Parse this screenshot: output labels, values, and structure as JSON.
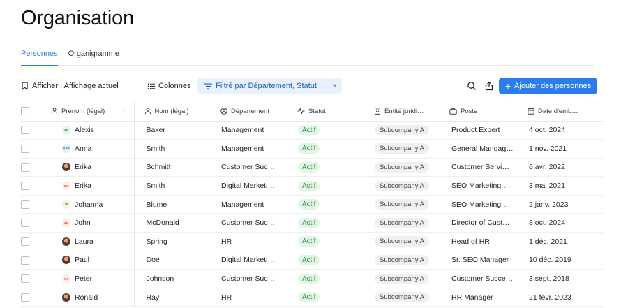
{
  "page": {
    "title": "Organisation"
  },
  "tabs": [
    {
      "label": "Personnes",
      "active": true
    },
    {
      "label": "Organigramme",
      "active": false
    }
  ],
  "toolbar": {
    "view_label": "Afficher : Affichage actuel",
    "columns_label": "Colonnes",
    "filter_label": "Filtré par Département, Statut",
    "filter_close": "×",
    "search_icon": "search-icon",
    "export_icon": "share-icon",
    "add_label": "Ajouter des personnes",
    "add_plus": "+"
  },
  "colors": {
    "accent": "#2b7de9",
    "active_badge_bg": "#e3f6e6",
    "active_badge_text": "#2e8a43"
  },
  "table": {
    "headers": {
      "first_name": "Prénom (légal)",
      "last_name": "Nom (légal)",
      "department": "Département",
      "status": "Statut",
      "entity": "Entité juridi…",
      "position": "Poste",
      "start_date": "Date d'emb…",
      "sort_arrow": "↑"
    },
    "rows": [
      {
        "initials": "AB",
        "av_bg": "#e6f4e6",
        "av_fg": "#3b8a45",
        "first": "Alexis",
        "last": "Baker",
        "dept": "Management",
        "status": "Actif",
        "entity": "Subcompany A",
        "position": "Product Expert",
        "date": "4 oct. 2024"
      },
      {
        "initials": "APP",
        "av_bg": "#e3eefc",
        "av_fg": "#2b6fd1",
        "first": "Anna",
        "last": "Smith",
        "dept": "Management",
        "status": "Actif",
        "entity": "Subcompany A",
        "position": "General Mangag…",
        "date": "1 nov. 2021"
      },
      {
        "initials": "",
        "av_bg": "photo",
        "av_fg": "",
        "first": "Erika",
        "last": "Schmitt",
        "dept": "Customer Suc…",
        "status": "Actif",
        "entity": "Subcompany A",
        "position": "Customer Servi…",
        "date": "6 avr. 2022"
      },
      {
        "initials": "ES",
        "av_bg": "#fdece4",
        "av_fg": "#c2653b",
        "first": "Erika",
        "last": "Smith",
        "dept": "Digital Marketi…",
        "status": "Actif",
        "entity": "Subcompany A",
        "position": "SEO Marketing …",
        "date": "3 mai 2021"
      },
      {
        "initials": "JB",
        "av_bg": "#eef5e3",
        "av_fg": "#6b8a2e",
        "first": "Johanna",
        "last": "Blume",
        "dept": "Management",
        "status": "Actif",
        "entity": "Subcompany A",
        "position": "SEO Marketing …",
        "date": "2 janv. 2023"
      },
      {
        "initials": "JM",
        "av_bg": "#fde8e6",
        "av_fg": "#c2453b",
        "first": "John",
        "last": "McDonald",
        "dept": "Customer Suc…",
        "status": "Actif",
        "entity": "Subcompany A",
        "position": "Director of Cust…",
        "date": "8 oct. 2024"
      },
      {
        "initials": "",
        "av_bg": "photo",
        "av_fg": "",
        "first": "Laura",
        "last": "Spring",
        "dept": "HR",
        "status": "Actif",
        "entity": "Subcompany A",
        "position": "Head of HR",
        "date": "1 déc. 2021"
      },
      {
        "initials": "",
        "av_bg": "photo",
        "av_fg": "",
        "first": "Paul",
        "last": "Doe",
        "dept": "Digital Marketi…",
        "status": "Actif",
        "entity": "Subcompany A",
        "position": "Sr. SEO Manager",
        "date": "10 déc. 2019"
      },
      {
        "initials": "PJ",
        "av_bg": "#fdebe8",
        "av_fg": "#c65a4a",
        "first": "Peter",
        "last": "Johnson",
        "dept": "Customer Suc…",
        "status": "Actif",
        "entity": "Subcompany A",
        "position": "Customer Succe…",
        "date": "3 sept. 2018"
      },
      {
        "initials": "",
        "av_bg": "photo",
        "av_fg": "",
        "first": "Ronald",
        "last": "Ray",
        "dept": "HR",
        "status": "Actif",
        "entity": "Subcompany A",
        "position": "HR Manager",
        "date": "21 févr. 2023"
      }
    ]
  }
}
